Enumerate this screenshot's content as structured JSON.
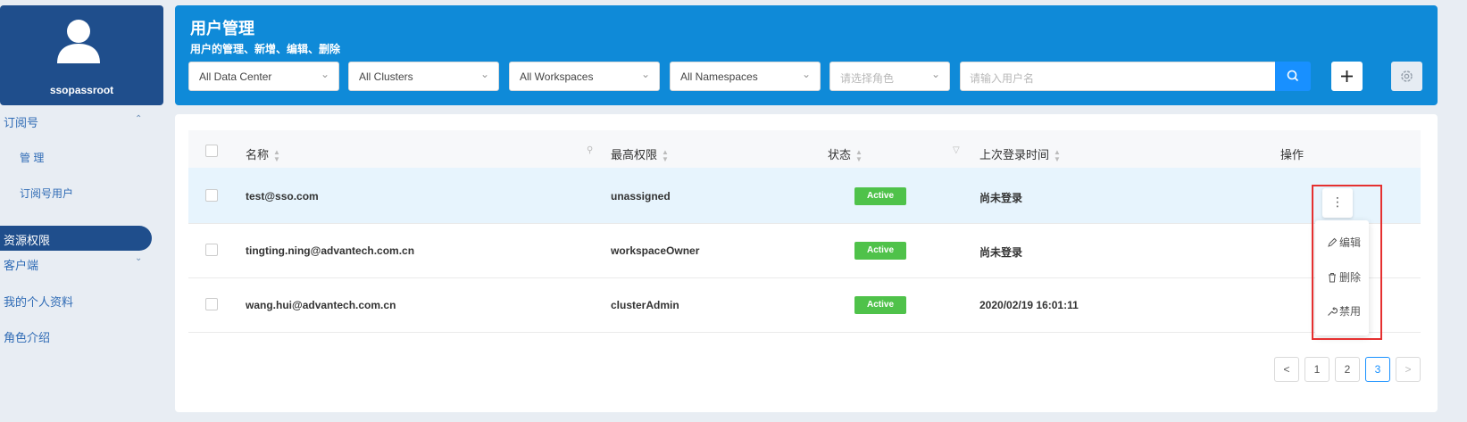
{
  "sidebar": {
    "username": "ssopassroot",
    "items": [
      {
        "label": "订阅号"
      },
      {
        "label": "管 理"
      },
      {
        "label": "订阅号用户"
      },
      {
        "label": "资源权限"
      },
      {
        "label": "客户端"
      },
      {
        "label": "我的个人资料"
      },
      {
        "label": "角色介绍"
      }
    ]
  },
  "header": {
    "title": "用户管理",
    "subtitle": "用户的管理、新增、编辑、删除",
    "filters": [
      {
        "value": "All Data Center"
      },
      {
        "value": "All Clusters"
      },
      {
        "value": "All Workspaces"
      },
      {
        "value": "All Namespaces"
      },
      {
        "placeholder": "请选择角色"
      }
    ],
    "search_placeholder": "请输入用户名"
  },
  "table": {
    "columns": {
      "name": "名称",
      "role": "最高权限",
      "status": "状态",
      "last_login": "上次登录时间",
      "action": "操作"
    },
    "rows": [
      {
        "name": "test@sso.com",
        "role": "unassigned",
        "status": "Active",
        "last_login": "尚未登录"
      },
      {
        "name": "tingting.ning@advantech.com.cn",
        "role": "workspaceOwner",
        "status": "Active",
        "last_login": "尚未登录"
      },
      {
        "name": "wang.hui@advantech.com.cn",
        "role": "clusterAdmin",
        "status": "Active",
        "last_login": "2020/02/19 16:01:11"
      }
    ]
  },
  "action_menu": {
    "edit": "编辑",
    "delete": "删除",
    "disable": "禁用",
    "more": "⋮"
  },
  "pagination": {
    "prev": "<",
    "next": ">",
    "pages": [
      "1",
      "2",
      "3"
    ],
    "current": "3"
  },
  "colors": {
    "header_bg": "#0f8ad8",
    "sidebar_profile_bg": "#1f4e8c",
    "accent": "#1890ff",
    "status_active": "#4fc24a",
    "highlight_box": "#e53030"
  }
}
